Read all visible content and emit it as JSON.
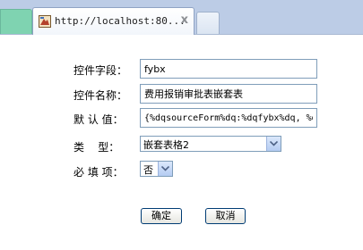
{
  "browser": {
    "tab_title": "http://localhost:80...",
    "tab_close_glyph": "x"
  },
  "form": {
    "fields": [
      {
        "label": "控件字段：",
        "value": "fybx"
      },
      {
        "label": "控件名称：",
        "value": "费用报销审批表嵌套表"
      },
      {
        "label": "默 认 值：",
        "value": "{%dqsourceForm%dq:%dqfybx%dq, %d"
      }
    ],
    "type_label": "类    型：",
    "type_value": "嵌套表格2",
    "required_label": "必 填 项：",
    "required_value": "否"
  },
  "buttons": {
    "ok_label": "确定",
    "cancel_label": "取消"
  }
}
